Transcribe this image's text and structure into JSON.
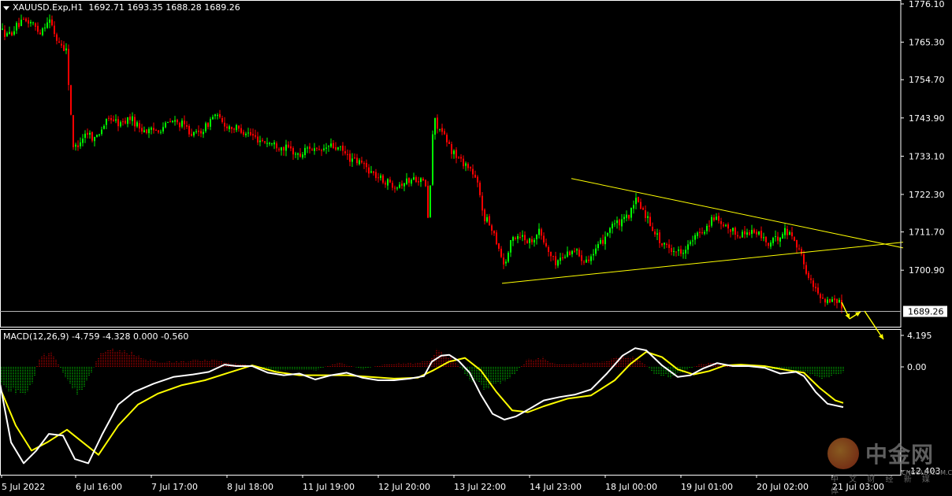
{
  "header": {
    "symbol": "XAUUSD.Exp,H1",
    "ohlc": "1692.71 1693.35 1688.28 1689.26"
  },
  "macd_header": "MACD(12,26,9) -4.759 -4.328 0.000 -0.560",
  "watermark": {
    "name": "中金网",
    "url": "CNGOLD.COM.CN",
    "sub": "中 文 财 经 新 媒 体"
  },
  "colors": {
    "background": "#000000",
    "bull_candle": "#00ff00",
    "bear_candle": "#ff0000",
    "axis": "#ffffff",
    "trendline": "#ffff00",
    "macd_line": "#ffffff",
    "signal_line": "#ffff00",
    "hist_pos": "#ff0000",
    "hist_neg": "#00ff00"
  },
  "chart_data": [
    {
      "type": "candlestick",
      "title": "XAUUSD.Exp,H1",
      "ylim": [
        1688.6,
        1776.1
      ],
      "y_ticks": [
        "1776.10",
        "1765.30",
        "1754.70",
        "1743.90",
        "1733.10",
        "1722.30",
        "1711.70",
        "1700.90"
      ],
      "x_ticks": [
        "5 Jul 2022",
        "6 Jul 16:00",
        "7 Jul 17:00",
        "8 Jul 18:00",
        "11 Jul 19:00",
        "12 Jul 20:00",
        "13 Jul 22:00",
        "14 Jul 23:00",
        "18 Jul 00:00",
        "19 Jul 01:00",
        "20 Jul 02:00",
        "21 Jul 03:00"
      ],
      "current_price": "1689.26",
      "close_path": [
        [
          0,
          1769
        ],
        [
          10,
          1767
        ],
        [
          22,
          1770
        ],
        [
          30,
          1771
        ],
        [
          40,
          1771
        ],
        [
          50,
          1768
        ],
        [
          62,
          1772
        ],
        [
          72,
          1766
        ],
        [
          84,
          1763
        ],
        [
          90,
          1745
        ],
        [
          93,
          1735
        ],
        [
          100,
          1737
        ],
        [
          110,
          1740
        ],
        [
          120,
          1738
        ],
        [
          132,
          1742
        ],
        [
          140,
          1744
        ],
        [
          152,
          1742
        ],
        [
          165,
          1744
        ],
        [
          178,
          1741
        ],
        [
          190,
          1740
        ],
        [
          204,
          1741
        ],
        [
          218,
          1743
        ],
        [
          232,
          1742
        ],
        [
          246,
          1739
        ],
        [
          260,
          1741
        ],
        [
          272,
          1745
        ],
        [
          284,
          1742
        ],
        [
          298,
          1741
        ],
        [
          312,
          1740
        ],
        [
          326,
          1738
        ],
        [
          340,
          1737
        ],
        [
          354,
          1736
        ],
        [
          368,
          1735
        ],
        [
          380,
          1733
        ],
        [
          392,
          1736
        ],
        [
          404,
          1734
        ],
        [
          418,
          1736
        ],
        [
          432,
          1735
        ],
        [
          446,
          1732
        ],
        [
          460,
          1731
        ],
        [
          474,
          1728
        ],
        [
          488,
          1726
        ],
        [
          502,
          1725
        ],
        [
          516,
          1726
        ],
        [
          530,
          1727
        ],
        [
          540,
          1725
        ],
        [
          544,
          1712
        ],
        [
          548,
          1738
        ],
        [
          552,
          1743
        ],
        [
          560,
          1740
        ],
        [
          572,
          1735
        ],
        [
          584,
          1732
        ],
        [
          596,
          1730
        ],
        [
          606,
          1725
        ],
        [
          614,
          1716
        ],
        [
          624,
          1713
        ],
        [
          632,
          1708
        ],
        [
          640,
          1702
        ],
        [
          650,
          1710
        ],
        [
          660,
          1711
        ],
        [
          672,
          1709
        ],
        [
          684,
          1712
        ],
        [
          694,
          1707
        ],
        [
          704,
          1703
        ],
        [
          716,
          1705
        ],
        [
          728,
          1707
        ],
        [
          740,
          1704
        ],
        [
          752,
          1705
        ],
        [
          764,
          1709
        ],
        [
          776,
          1714
        ],
        [
          788,
          1714
        ],
        [
          800,
          1717
        ],
        [
          808,
          1721
        ],
        [
          818,
          1717
        ],
        [
          828,
          1713
        ],
        [
          840,
          1708
        ],
        [
          852,
          1707
        ],
        [
          862,
          1706
        ],
        [
          874,
          1708
        ],
        [
          886,
          1711
        ],
        [
          896,
          1713
        ],
        [
          906,
          1716
        ],
        [
          916,
          1713
        ],
        [
          928,
          1712
        ],
        [
          940,
          1711
        ],
        [
          952,
          1712
        ],
        [
          964,
          1711
        ],
        [
          976,
          1708
        ],
        [
          986,
          1710
        ],
        [
          996,
          1712
        ],
        [
          1004,
          1711
        ],
        [
          1012,
          1708
        ],
        [
          1018,
          1704
        ],
        [
          1024,
          1700
        ],
        [
          1032,
          1696
        ],
        [
          1040,
          1694
        ],
        [
          1050,
          1692
        ],
        [
          1060,
          1693
        ],
        [
          1070,
          1690
        ],
        [
          1072,
          1689.26
        ]
      ],
      "trendlines": [
        {
          "from": [
            637,
            1697.2
          ],
          "to": [
            1146,
            1708.8
          ]
        },
        {
          "from": [
            725,
            1726.8
          ],
          "to": [
            1146,
            1707.2
          ]
        }
      ]
    },
    {
      "type": "macd",
      "title": "MACD(12,26,9)",
      "macd": -4.759,
      "signal": -4.328,
      "hist": -0.56,
      "ylim": [
        -12.403,
        4.195
      ],
      "y_ticks": [
        "4.195",
        "0.00",
        "-12.403"
      ],
      "macd_path": [
        [
          0,
          -2
        ],
        [
          14,
          -9
        ],
        [
          30,
          -11.5
        ],
        [
          46,
          -10
        ],
        [
          62,
          -8
        ],
        [
          80,
          -8.2
        ],
        [
          95,
          -11
        ],
        [
          112,
          -11.5
        ],
        [
          130,
          -8
        ],
        [
          150,
          -4.5
        ],
        [
          170,
          -3
        ],
        [
          195,
          -2
        ],
        [
          220,
          -1.2
        ],
        [
          245,
          -0.9
        ],
        [
          265,
          -0.6
        ],
        [
          285,
          0.3
        ],
        [
          300,
          0.1
        ],
        [
          320,
          0.1
        ],
        [
          340,
          -0.7
        ],
        [
          360,
          -1
        ],
        [
          380,
          -0.8
        ],
        [
          400,
          -1.5
        ],
        [
          420,
          -1
        ],
        [
          440,
          -0.7
        ],
        [
          460,
          -1.3
        ],
        [
          480,
          -1.6
        ],
        [
          500,
          -1.6
        ],
        [
          520,
          -1.4
        ],
        [
          538,
          -1.1
        ],
        [
          548,
          0.7
        ],
        [
          560,
          1.5
        ],
        [
          570,
          1.6
        ],
        [
          582,
          0.8
        ],
        [
          596,
          -0.7
        ],
        [
          610,
          -3.3
        ],
        [
          625,
          -5.6
        ],
        [
          640,
          -6.3
        ],
        [
          655,
          -5.9
        ],
        [
          672,
          -5
        ],
        [
          690,
          -4
        ],
        [
          710,
          -3.6
        ],
        [
          730,
          -3.3
        ],
        [
          750,
          -2.7
        ],
        [
          770,
          -0.8
        ],
        [
          790,
          1.5
        ],
        [
          806,
          2.5
        ],
        [
          820,
          2.2
        ],
        [
          840,
          0.2
        ],
        [
          860,
          -1.2
        ],
        [
          876,
          -1
        ],
        [
          892,
          -0.2
        ],
        [
          910,
          0.5
        ],
        [
          930,
          0.1
        ],
        [
          950,
          0.1
        ],
        [
          970,
          -0.1
        ],
        [
          990,
          -0.8
        ],
        [
          1010,
          -0.6
        ],
        [
          1020,
          -1.1
        ],
        [
          1035,
          -3
        ],
        [
          1050,
          -4.4
        ],
        [
          1070,
          -4.8
        ]
      ],
      "signal_path": [
        [
          0,
          -2.5
        ],
        [
          20,
          -7
        ],
        [
          40,
          -10
        ],
        [
          60,
          -9
        ],
        [
          85,
          -7.5
        ],
        [
          105,
          -9
        ],
        [
          125,
          -10.5
        ],
        [
          150,
          -7
        ],
        [
          175,
          -4.5
        ],
        [
          200,
          -3.2
        ],
        [
          230,
          -2.2
        ],
        [
          260,
          -1.6
        ],
        [
          290,
          -0.7
        ],
        [
          320,
          0.2
        ],
        [
          350,
          -0.6
        ],
        [
          380,
          -1
        ],
        [
          410,
          -1
        ],
        [
          440,
          -1
        ],
        [
          470,
          -1.2
        ],
        [
          500,
          -1.4
        ],
        [
          530,
          -1.3
        ],
        [
          550,
          -0.4
        ],
        [
          570,
          0.7
        ],
        [
          590,
          1.2
        ],
        [
          610,
          -0.4
        ],
        [
          630,
          -3
        ],
        [
          650,
          -5.2
        ],
        [
          670,
          -5.4
        ],
        [
          690,
          -4.7
        ],
        [
          720,
          -3.8
        ],
        [
          750,
          -3.4
        ],
        [
          780,
          -1.6
        ],
        [
          800,
          0.4
        ],
        [
          820,
          2
        ],
        [
          840,
          1.3
        ],
        [
          860,
          -0.3
        ],
        [
          880,
          -0.9
        ],
        [
          900,
          -0.5
        ],
        [
          920,
          0.2
        ],
        [
          940,
          0.3
        ],
        [
          970,
          0.1
        ],
        [
          1000,
          -0.4
        ],
        [
          1020,
          -0.7
        ],
        [
          1040,
          -2.5
        ],
        [
          1060,
          -4
        ],
        [
          1070,
          -4.3
        ]
      ],
      "hist_profile": [
        [
          0,
          -2.2
        ],
        [
          25,
          -3.5
        ],
        [
          40,
          -2.5
        ],
        [
          50,
          1.3
        ],
        [
          65,
          1.9
        ],
        [
          85,
          -1.5
        ],
        [
          100,
          -3.2
        ],
        [
          115,
          -1
        ],
        [
          125,
          1.4
        ],
        [
          140,
          2.4
        ],
        [
          160,
          2.2
        ],
        [
          180,
          1.2
        ],
        [
          200,
          0.6
        ],
        [
          240,
          0.8
        ],
        [
          270,
          0.9
        ],
        [
          295,
          0.5
        ],
        [
          320,
          0.2
        ],
        [
          345,
          -0.5
        ],
        [
          370,
          -0.3
        ],
        [
          400,
          -0.4
        ],
        [
          430,
          0.6
        ],
        [
          460,
          -0.3
        ],
        [
          490,
          0.4
        ],
        [
          530,
          0.5
        ],
        [
          545,
          0.9
        ],
        [
          555,
          2.2
        ],
        [
          570,
          1.5
        ],
        [
          595,
          -1.3
        ],
        [
          610,
          -2.3
        ],
        [
          625,
          -2.6
        ],
        [
          640,
          -1.7
        ],
        [
          655,
          -0.6
        ],
        [
          670,
          1
        ],
        [
          690,
          1.2
        ],
        [
          705,
          0.4
        ],
        [
          725,
          0.4
        ],
        [
          745,
          0.5
        ],
        [
          765,
          0.7
        ],
        [
          780,
          1.2
        ],
        [
          795,
          1.5
        ],
        [
          812,
          0.9
        ],
        [
          830,
          -0.8
        ],
        [
          850,
          -1.3
        ],
        [
          870,
          -0.4
        ],
        [
          890,
          0.4
        ],
        [
          905,
          0.6
        ],
        [
          925,
          0.2
        ],
        [
          945,
          0.1
        ],
        [
          965,
          -0.2
        ],
        [
          985,
          -0.3
        ],
        [
          1005,
          -0.5
        ],
        [
          1020,
          -0.7
        ],
        [
          1040,
          -1.3
        ],
        [
          1060,
          -1
        ],
        [
          1070,
          -0.6
        ]
      ]
    }
  ]
}
